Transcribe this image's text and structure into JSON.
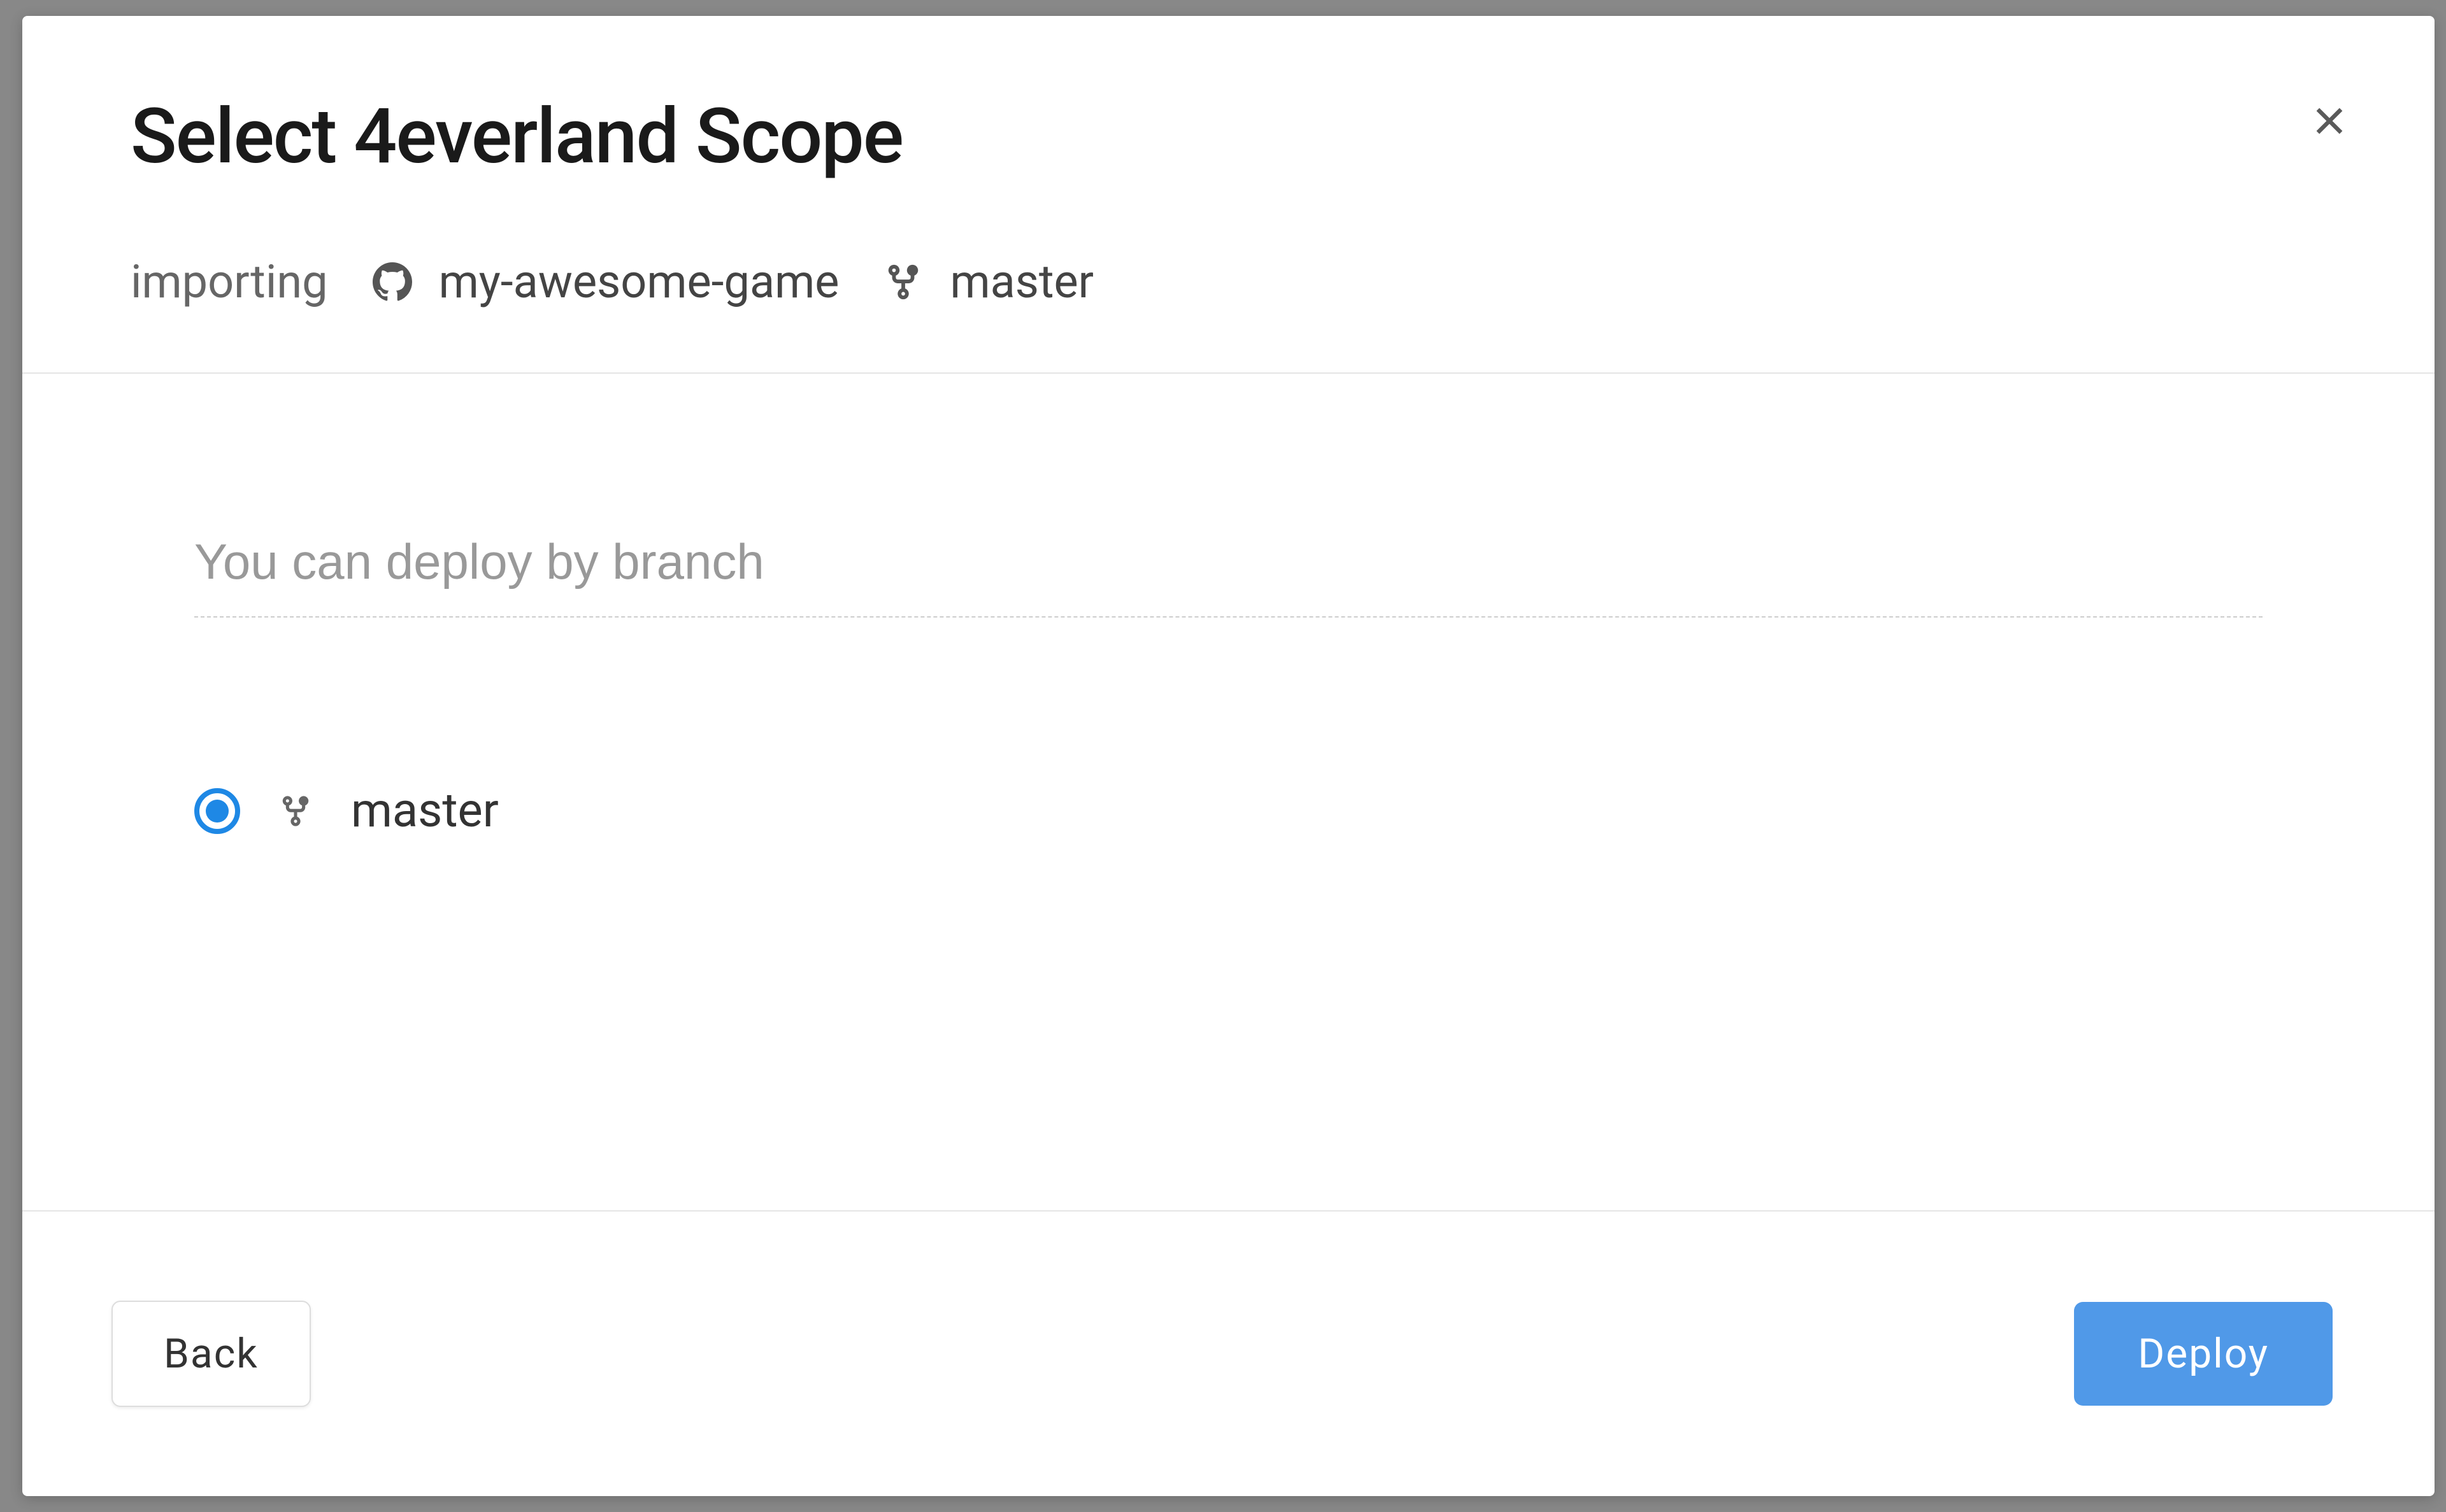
{
  "modal": {
    "title": "Select 4everland Scope",
    "subtitle": {
      "importing_label": "importing",
      "repo_name": "my-awesome-game",
      "branch_name": "master"
    },
    "search": {
      "placeholder": "You can deploy by branch"
    },
    "branches": [
      {
        "name": "master",
        "selected": true
      }
    ],
    "footer": {
      "back_label": "Back",
      "deploy_label": "Deploy"
    }
  }
}
